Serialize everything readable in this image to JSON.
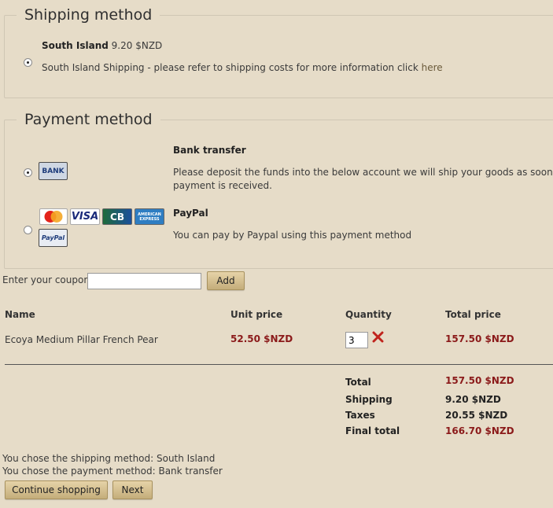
{
  "shipping": {
    "legend": "Shipping method",
    "option_name": "South Island",
    "option_price": "9.20 $NZD",
    "description": "South Island Shipping - please refer to shipping costs for more information click",
    "link_text": "here"
  },
  "payment": {
    "legend": "Payment method",
    "bank": {
      "title": "Bank transfer",
      "logo_text": "BANK",
      "description_line1": "Please deposit the funds into the below account we will ship your goods as soon as",
      "description_line2": "payment is received."
    },
    "paypal": {
      "title": "PayPal",
      "description": "You can pay by Paypal using this payment method",
      "cards": [
        "MasterCard",
        "VISA",
        "CB",
        "AMERICAN EXPRESS"
      ],
      "logo_text": "PayPal"
    }
  },
  "coupon": {
    "label": "Enter your coupon",
    "value": "",
    "add_label": "Add"
  },
  "cart": {
    "headers": {
      "name": "Name",
      "unit_price": "Unit price",
      "quantity": "Quantity",
      "total_price": "Total price"
    },
    "rows": [
      {
        "name": "Ecoya Medium Pillar French Pear",
        "unit_price": "52.50 $NZD",
        "quantity": "3",
        "total_price": "157.50 $NZD"
      }
    ]
  },
  "summary": {
    "total_label": "Total",
    "total_value": "157.50 $NZD",
    "shipping_label": "Shipping",
    "shipping_value": "9.20 $NZD",
    "taxes_label": "Taxes",
    "taxes_value": "20.55 $NZD",
    "final_label": "Final total",
    "final_value": "166.70 $NZD"
  },
  "choices": {
    "shipping_line": "You chose the shipping method: South Island",
    "payment_line": "You chose the payment method: Bank transfer"
  },
  "actions": {
    "continue_label": "Continue shopping",
    "next_label": "Next"
  },
  "colors": {
    "background": "#e6dcc8",
    "price_red": "#8b1a1a",
    "button": "#d6c291",
    "remove_x": "#c0231c"
  }
}
